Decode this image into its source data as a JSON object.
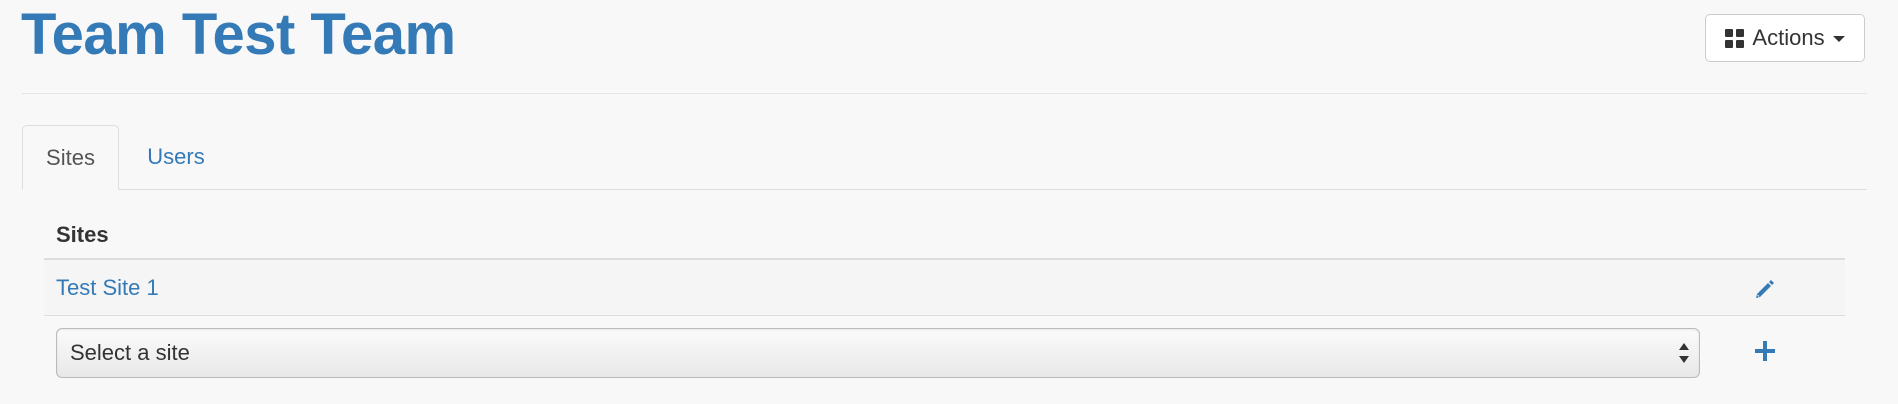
{
  "header": {
    "title": "Team Test Team",
    "actions_label": "Actions",
    "actions_icon": "grid-icon"
  },
  "tabs": [
    {
      "label": "Sites",
      "active": true
    },
    {
      "label": "Users",
      "active": false
    }
  ],
  "sites_table": {
    "header": "Sites",
    "rows": [
      {
        "name": "Test Site 1",
        "action_icon": "pencil-icon"
      }
    ],
    "select": {
      "value": "Select a site"
    },
    "add_icon": "plus-icon"
  },
  "colors": {
    "accent": "#337ab7",
    "background": "#f8f8f8",
    "text": "#333333"
  }
}
